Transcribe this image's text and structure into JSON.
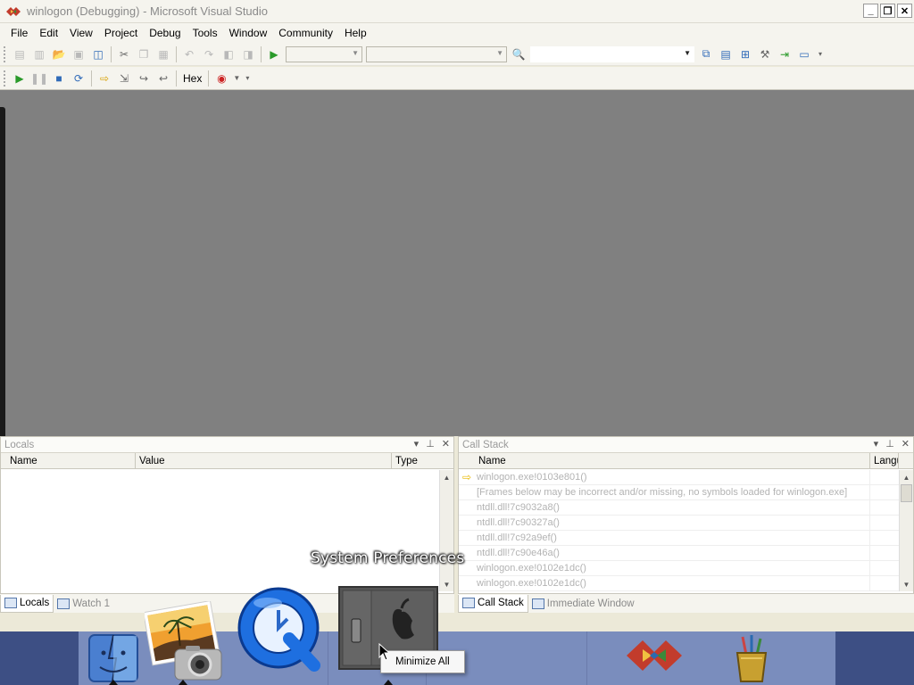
{
  "window": {
    "title": "winlogon (Debugging) - Microsoft Visual Studio",
    "minimize": "_",
    "restore": "❐",
    "close": "✕"
  },
  "menu": [
    "File",
    "Edit",
    "View",
    "Project",
    "Debug",
    "Tools",
    "Window",
    "Community",
    "Help"
  ],
  "toolbar2": {
    "hex_label": "Hex"
  },
  "locals_panel": {
    "title": "Locals",
    "columns": [
      "Name",
      "Value",
      "Type"
    ],
    "tabs": [
      "Locals",
      "Watch 1"
    ]
  },
  "callstack_panel": {
    "title": "Call Stack",
    "columns": [
      "Name",
      "Langu"
    ],
    "rows": [
      "winlogon.exe!0103e801()",
      "[Frames below may be incorrect and/or missing, no symbols loaded for winlogon.exe]",
      "ntdll.dll!7c9032a8()",
      "ntdll.dll!7c90327a()",
      "ntdll.dll!7c92a9ef()",
      "ntdll.dll!7c90e46a()",
      "winlogon.exe!0102e1dc()",
      "winlogon.exe!0102e1dc()"
    ],
    "tabs": [
      "Call Stack",
      "Immediate Window"
    ]
  },
  "dock": {
    "hover_label": "System Preferences",
    "context_menu_item": "Minimize All",
    "icons": [
      "finder-icon",
      "iphoto-icon",
      "quicktime-icon",
      "system-preferences-icon",
      "visual-studio-icon",
      "pencil-cup-icon"
    ]
  }
}
